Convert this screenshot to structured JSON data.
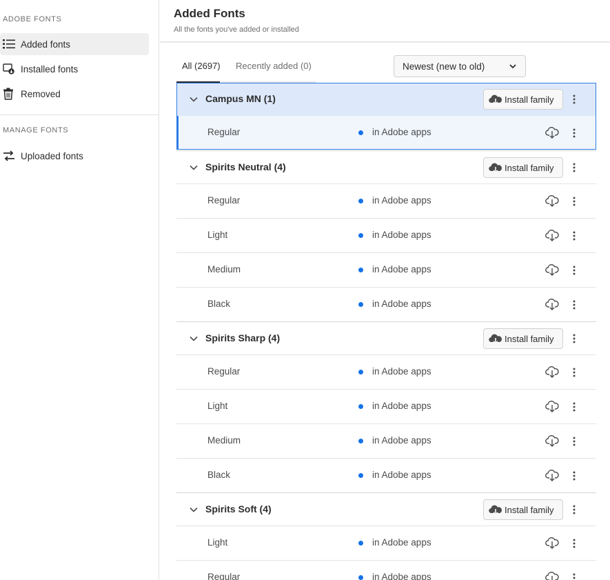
{
  "sidebar": {
    "adobe_fonts_label": "ADOBE FONTS",
    "manage_fonts_label": "MANAGE FONTS",
    "items": [
      {
        "label": "Added fonts",
        "icon": "list-icon",
        "active": true
      },
      {
        "label": "Installed fonts",
        "icon": "installed-icon",
        "active": false
      },
      {
        "label": "Removed",
        "icon": "trash-icon",
        "active": false
      },
      {
        "label": "Uploaded fonts",
        "icon": "transfer-icon",
        "active": false
      }
    ]
  },
  "header": {
    "title": "Added Fonts",
    "subtitle": "All the fonts you've added or installed"
  },
  "tabs": [
    {
      "label": "All (2697)",
      "active": true
    },
    {
      "label": "Recently added (0)",
      "active": false
    }
  ],
  "sort": {
    "selected": "Newest (new to old)"
  },
  "install_label": "Install family",
  "families": [
    {
      "name": "Campus MN (1)",
      "selected": true,
      "styles": [
        {
          "name": "Regular",
          "status": "in Adobe apps"
        }
      ]
    },
    {
      "name": "Spirits Neutral (4)",
      "styles": [
        {
          "name": "Regular",
          "status": "in Adobe apps"
        },
        {
          "name": "Light",
          "status": "in Adobe apps"
        },
        {
          "name": "Medium",
          "status": "in Adobe apps"
        },
        {
          "name": "Black",
          "status": "in Adobe apps"
        }
      ]
    },
    {
      "name": "Spirits Sharp (4)",
      "styles": [
        {
          "name": "Regular",
          "status": "in Adobe apps"
        },
        {
          "name": "Light",
          "status": "in Adobe apps"
        },
        {
          "name": "Medium",
          "status": "in Adobe apps"
        },
        {
          "name": "Black",
          "status": "in Adobe apps"
        }
      ]
    },
    {
      "name": "Spirits Soft (4)",
      "styles": [
        {
          "name": "Light",
          "status": "in Adobe apps"
        },
        {
          "name": "Regular",
          "status": "in Adobe apps"
        }
      ]
    }
  ],
  "colors": {
    "accent": "#1473e6",
    "selection": "#dde9fa"
  }
}
